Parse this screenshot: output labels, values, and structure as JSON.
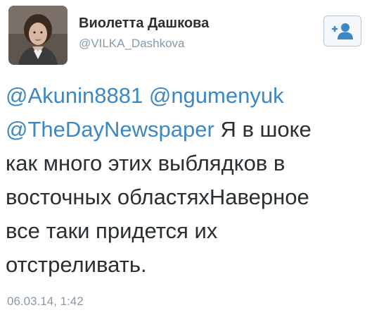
{
  "user": {
    "display_name": "Виолетта Дашкова",
    "handle": "@VILKA_Dashkova"
  },
  "follow_button": {
    "icon": "add-user-icon",
    "accent": "#3b88c3"
  },
  "tweet": {
    "mentions": [
      "@Akunin8881",
      "@ngumenyuk",
      "@TheDayNewspaper"
    ],
    "text_after_mentions": "Я в шоке",
    "lines": [
      "как много этих выблядков в",
      "восточных областяхНаверное",
      "все таки придется их",
      "отстреливать."
    ],
    "timestamp": "06.03.14, 1:42"
  },
  "colors": {
    "mention": "#3b88c3",
    "text": "#292f33",
    "muted": "#8899a6"
  }
}
